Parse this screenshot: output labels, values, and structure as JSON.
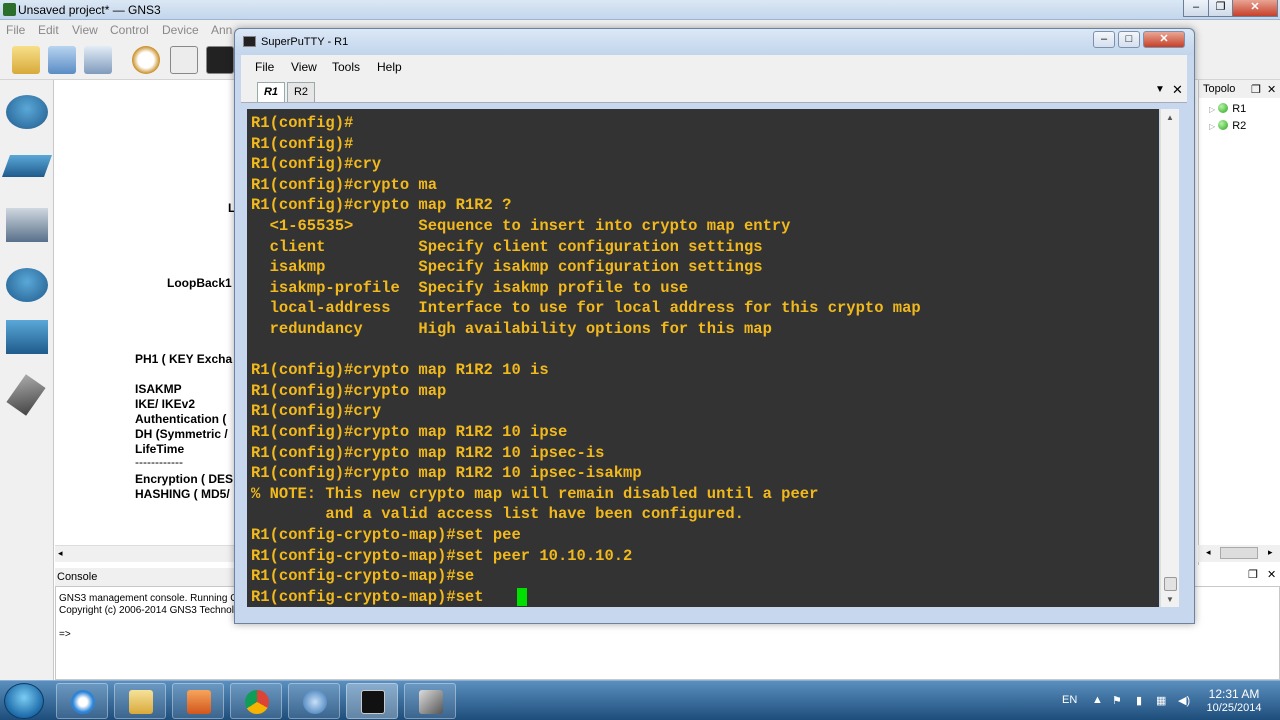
{
  "gns": {
    "title": "Unsaved project* — GNS3",
    "menu": [
      "File",
      "Edit",
      "View",
      "Control",
      "Device",
      "Ann"
    ],
    "canvas_labels": {
      "loopback": "LoopBack1",
      "ph1": "PH1 ( KEY Excha",
      "isakmp": "ISAKMP",
      "ike": "IKE/ IKEv2",
      "auth": "Authentication (",
      "dh": "DH (Symmetric /",
      "lifetime": "LifeTime",
      "sep": "------------",
      "encryption": "Encryption ( DES",
      "hashing": "HASHING ( MD5/",
      "partial_l": "L"
    },
    "console": {
      "title": "Console",
      "lines": [
        "GNS3 management console. Running G",
        "Copyright (c) 2006-2014 GNS3 Technol",
        "=>"
      ]
    },
    "topology": {
      "title": "Topolo",
      "nodes": [
        "R1",
        "R2"
      ],
      "node_status_color": "#27a21b"
    }
  },
  "putty": {
    "title": "SuperPuTTY - R1",
    "menu": [
      "File",
      "View",
      "Tools",
      "Help"
    ],
    "tabs": [
      {
        "label": "R1",
        "active": true
      },
      {
        "label": "R2",
        "active": false
      }
    ],
    "terminal_color": "#f2b91d",
    "terminal_bg": "#333333",
    "cursor_color": "#00e000",
    "lines": [
      "R1(config)#",
      "R1(config)#",
      "R1(config)#cry",
      "R1(config)#crypto ma",
      "R1(config)#crypto map R1R2 ?",
      "  <1-65535>       Sequence to insert into crypto map entry",
      "  client          Specify client configuration settings",
      "  isakmp          Specify isakmp configuration settings",
      "  isakmp-profile  Specify isakmp profile to use",
      "  local-address   Interface to use for local address for this crypto map",
      "  redundancy      High availability options for this map",
      "",
      "R1(config)#crypto map R1R2 10 is",
      "R1(config)#crypto map",
      "R1(config)#cry",
      "R1(config)#crypto map R1R2 10 ipse",
      "R1(config)#crypto map R1R2 10 ipsec-is",
      "R1(config)#crypto map R1R2 10 ipsec-isakmp",
      "% NOTE: This new crypto map will remain disabled until a peer",
      "        and a valid access list have been configured.",
      "R1(config-crypto-map)#set pee",
      "R1(config-crypto-map)#set peer 10.10.10.2",
      "R1(config-crypto-map)#se",
      "R1(config-crypto-map)#set "
    ]
  },
  "taskbar": {
    "lang": "EN",
    "time": "12:31 AM",
    "date": "10/25/2014",
    "apps": [
      "explorer-icon",
      "internet-explorer-icon",
      "folder-icon",
      "media-player-icon",
      "chrome-icon",
      "gns3-icon",
      "terminal-icon",
      "tools-icon"
    ]
  }
}
